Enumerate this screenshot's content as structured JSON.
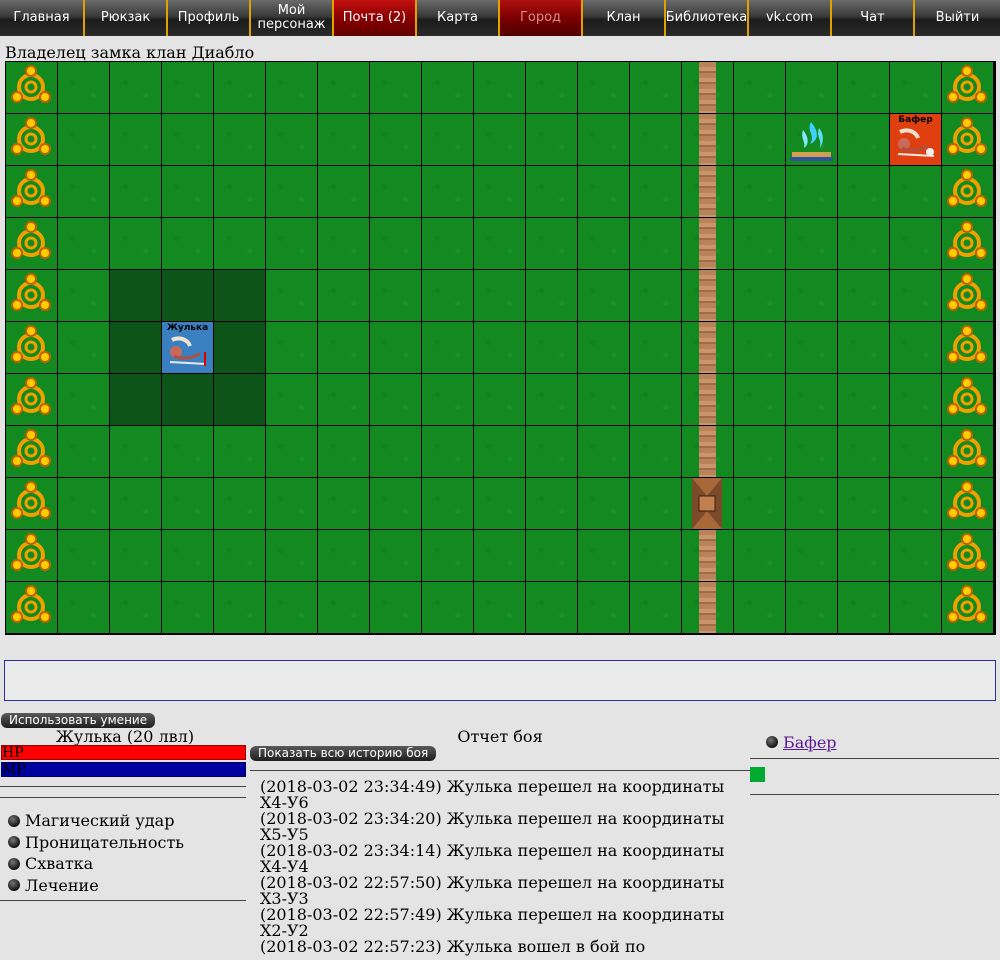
{
  "nav": [
    {
      "label": "Главная",
      "style": "normal",
      "w": 85
    },
    {
      "label": "Рюкзак",
      "style": "normal",
      "w": 83
    },
    {
      "label": "Профиль",
      "style": "normal",
      "w": 83
    },
    {
      "label": "Мой\nперсонаж",
      "style": "normal",
      "w": 83
    },
    {
      "label": "Почта (2)",
      "style": "red",
      "w": 83
    },
    {
      "label": "Карта",
      "style": "normal",
      "w": 83
    },
    {
      "label": "Город",
      "style": "dim",
      "w": 83
    },
    {
      "label": "Клан",
      "style": "normal",
      "w": 83
    },
    {
      "label": "Библиотека",
      "style": "normal",
      "w": 83
    },
    {
      "label": "vk.com",
      "style": "normal",
      "w": 83
    },
    {
      "label": "Чат",
      "style": "normal",
      "w": 83
    },
    {
      "label": "Выйти",
      "style": "normal",
      "w": 85
    }
  ],
  "castle_owner": "Владелец замка клан Диабло",
  "map": {
    "cols": 19,
    "rows": 11,
    "portal_cols": [
      0,
      18
    ],
    "wall_col": 13,
    "gate_row": 8,
    "dark_cells": [
      [
        2,
        4
      ],
      [
        3,
        4
      ],
      [
        4,
        4
      ],
      [
        2,
        5
      ],
      [
        4,
        5
      ],
      [
        2,
        6
      ],
      [
        3,
        6
      ],
      [
        4,
        6
      ]
    ],
    "units": [
      {
        "name": "Жулька",
        "col": 3,
        "row": 5,
        "kind": "jul"
      },
      {
        "name": "Бафер",
        "col": 17,
        "row": 1,
        "kind": "baf"
      }
    ],
    "altar": {
      "col": 15,
      "row": 1
    },
    "colors": {
      "grass": "#128a20",
      "grass_dark": "#0d5418",
      "grid": "#000000"
    }
  },
  "use_skill_label": "Использовать умение",
  "character": {
    "name": "Жулька (20 лвл)",
    "hp_label": "HP",
    "mp_label": "MP"
  },
  "skills": [
    "Магический удар",
    "Проницательность",
    "Схватка",
    "Лечение"
  ],
  "battle": {
    "title": "Отчет боя",
    "show_history_label": "Показать всю историю боя",
    "log": [
      "(2018-03-02 23:34:49) Жулька перешел на координаты Х4-У6",
      "(2018-03-02 23:34:20) Жулька перешел на координаты Х5-У5",
      "(2018-03-02 23:34:14) Жулька перешел на координаты Х4-У4",
      "(2018-03-02 22:57:50) Жулька перешел на координаты Х3-У3",
      "(2018-03-02 22:57:49) Жулька перешел на координаты Х2-У2",
      "(2018-03-02 22:57:23) Жулька вошел в бой по"
    ]
  },
  "participants": [
    "Бафер"
  ]
}
